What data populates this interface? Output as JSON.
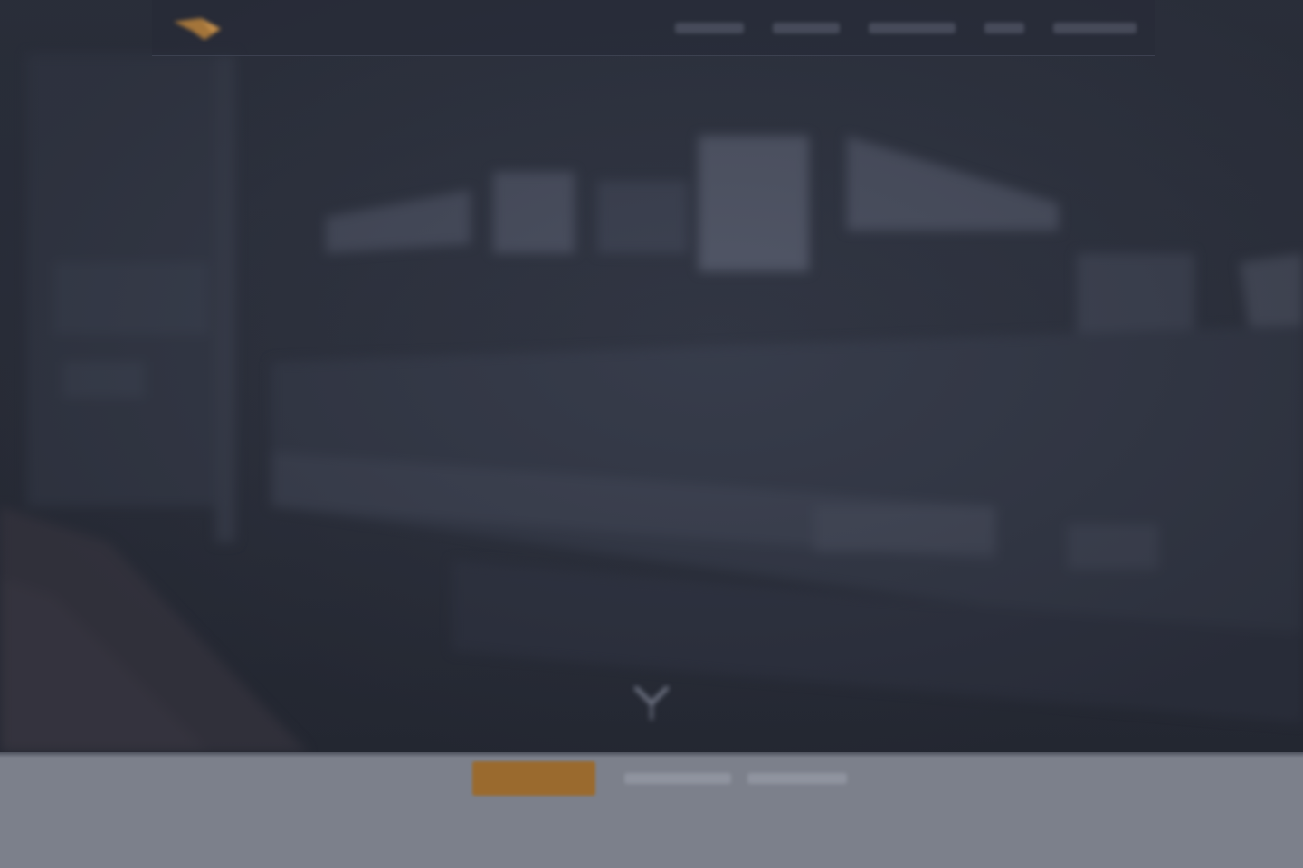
{
  "header": {
    "logo_text": "",
    "nav_items": [
      {
        "label": ""
      },
      {
        "label": ""
      },
      {
        "label": ""
      },
      {
        "label": ""
      },
      {
        "label": ""
      }
    ]
  },
  "hero": {
    "title_line_1": "",
    "title_line_2": ""
  },
  "lower_section": {
    "primary_button_label": "",
    "links": [
      {
        "label": ""
      },
      {
        "label": ""
      }
    ]
  },
  "colors": {
    "hero_background": "#2c303c",
    "navbar_background": "#262a36",
    "accent": "#9a6a2e",
    "lower_background": "#7c808b",
    "hero_text": "#d3d7e1"
  },
  "icons": {
    "logo": "brand-logo-icon",
    "scroll": "scroll-down-icon"
  }
}
